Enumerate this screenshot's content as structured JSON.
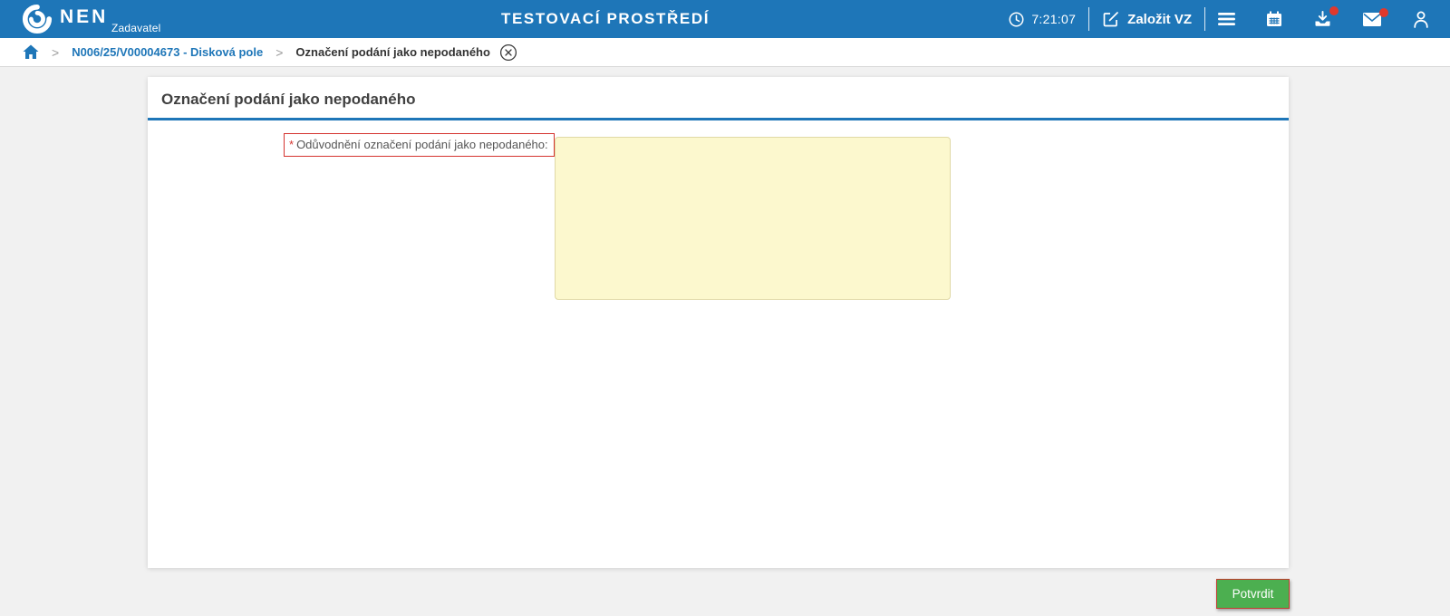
{
  "header": {
    "brand": "NEN",
    "brand_role": "Zadavatel",
    "environment_title": "TESTOVACÍ PROSTŘEDÍ",
    "time": "7:21:07",
    "create_vz_label": "Založit VZ",
    "icons": [
      {
        "name": "clock-icon",
        "badge": false
      },
      {
        "name": "edit-square-icon",
        "badge": false
      },
      {
        "name": "menu-icon",
        "badge": false
      },
      {
        "name": "calendar-icon",
        "badge": false
      },
      {
        "name": "download-tray-icon",
        "badge": true
      },
      {
        "name": "mail-icon",
        "badge": true
      },
      {
        "name": "user-icon",
        "badge": false
      }
    ]
  },
  "breadcrumb": {
    "separator": ">",
    "home_icon": "home-icon",
    "items": [
      {
        "label": "N006/25/V00004673 - Disková pole",
        "type": "link"
      },
      {
        "label": "Označení podání jako nepodaného",
        "type": "current"
      }
    ],
    "close_icon": "close-circle-icon"
  },
  "main": {
    "panel_title": "Označení podání jako nepodaného",
    "form": {
      "required_mark": "*",
      "label": "Odůvodnění označení podání jako nepodaného:",
      "textarea_value": ""
    },
    "confirm_button_label": "Potvrdit"
  },
  "colors": {
    "header_bg": "#1e76b8",
    "accent_blue": "#1e76b8",
    "page_bg": "#f1f1f1",
    "panel_bg": "#ffffff",
    "textarea_bg": "#fcf8ce",
    "textarea_border": "#e0d9a6",
    "required_border": "#d5342f",
    "button_bg": "#4caf50",
    "button_border": "#c23b2e",
    "notification_dot": "#e0382d"
  }
}
